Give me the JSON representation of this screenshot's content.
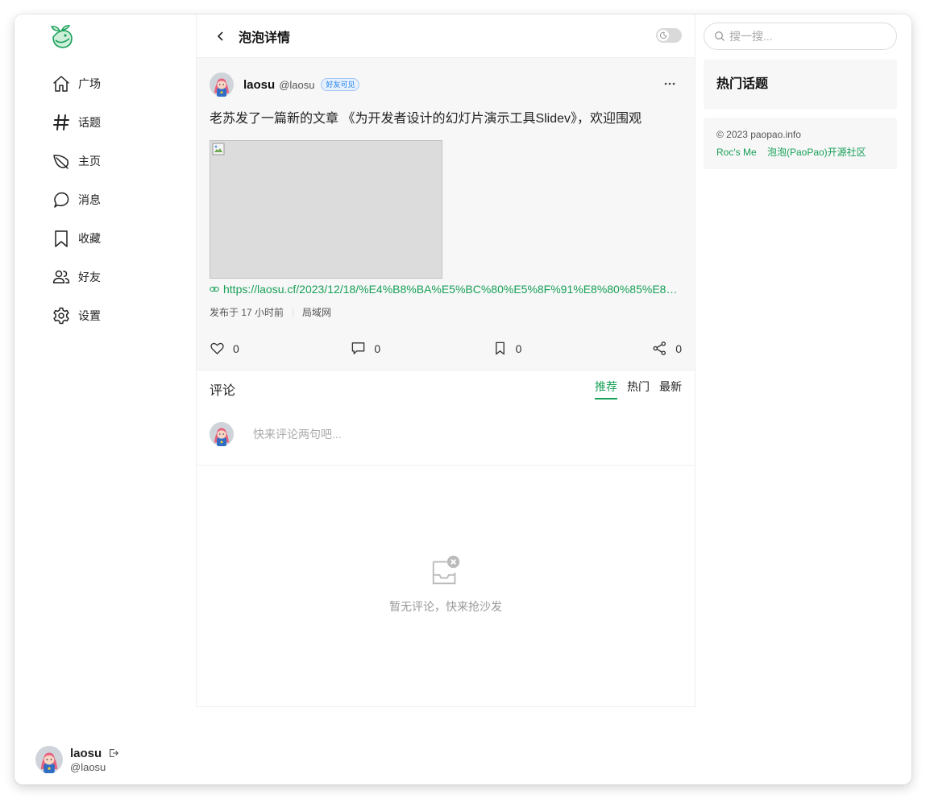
{
  "sidebar": {
    "logo": "paopao-logo",
    "items": [
      {
        "label": "广场",
        "icon": "home-icon"
      },
      {
        "label": "话题",
        "icon": "hash-icon"
      },
      {
        "label": "主页",
        "icon": "leaf-icon"
      },
      {
        "label": "消息",
        "icon": "chat-icon"
      },
      {
        "label": "收藏",
        "icon": "bookmark-icon"
      },
      {
        "label": "好友",
        "icon": "people-icon"
      },
      {
        "label": "设置",
        "icon": "settings-icon"
      }
    ],
    "user": {
      "name": "laosu",
      "handle": "@laosu"
    }
  },
  "header": {
    "title": "泡泡详情"
  },
  "post": {
    "author": "laosu",
    "handle": "@laosu",
    "visibility": "好友可见",
    "text": "老苏发了一篇新的文章 《为开发者设计的幻灯片演示工具Slidev》，欢迎围观",
    "link": "https://laosu.cf/2023/12/18/%E4%B8%BA%E5%BC%80%E5%8F%91%E8%80%85%E8%...",
    "time": "发布于 17 小时前",
    "location": "局域网",
    "likes": "0",
    "comments": "0",
    "collections": "0",
    "shares": "0"
  },
  "comments": {
    "title": "评论",
    "tabs": [
      "推荐",
      "热门",
      "最新"
    ],
    "active_tab": "推荐",
    "placeholder": "快来评论两句吧...",
    "empty": "暂无评论，快来抢沙发"
  },
  "right": {
    "search_placeholder": "搜一搜...",
    "hot_title": "热门话题",
    "copyright": "© 2023 paopao.info",
    "links": [
      "Roc's Me",
      "泡泡(PaoPao)开源社区"
    ]
  },
  "colors": {
    "accent": "#18a058",
    "badge": "#2080f0"
  }
}
